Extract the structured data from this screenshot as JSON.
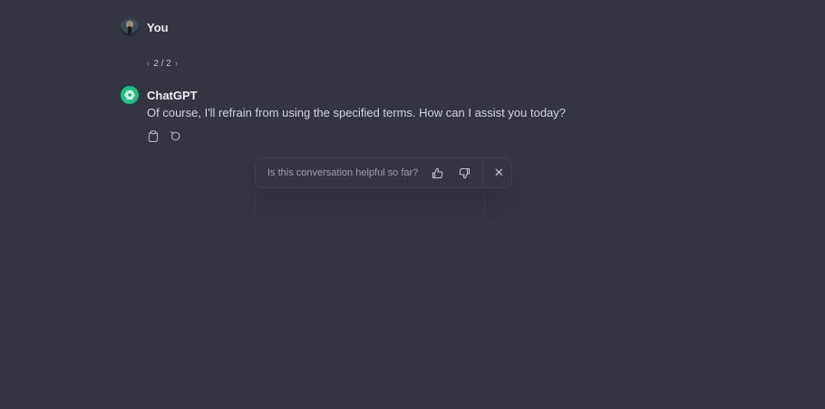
{
  "user_message": {
    "sender": "You"
  },
  "pager": {
    "prev_icon": "‹",
    "text": "2 / 2",
    "next_icon": "›"
  },
  "bot_message": {
    "sender": "ChatGPT",
    "text": "Of course, I'll refrain from using the specified terms. How can I assist you today?"
  },
  "actions": {
    "icons": [
      "clipboard-icon",
      "regenerate-icon"
    ]
  },
  "feedback": {
    "question": "Is this conversation helpful so far?",
    "icons": [
      "thumbs-up-icon",
      "thumbs-down-icon",
      "close-icon"
    ],
    "close_glyph": "✕"
  },
  "colors": {
    "background": "#343541",
    "bot_avatar": "#19c37d",
    "text_primary": "#ececf1",
    "text_secondary": "#d1d5db",
    "muted": "#a0a0ad"
  }
}
